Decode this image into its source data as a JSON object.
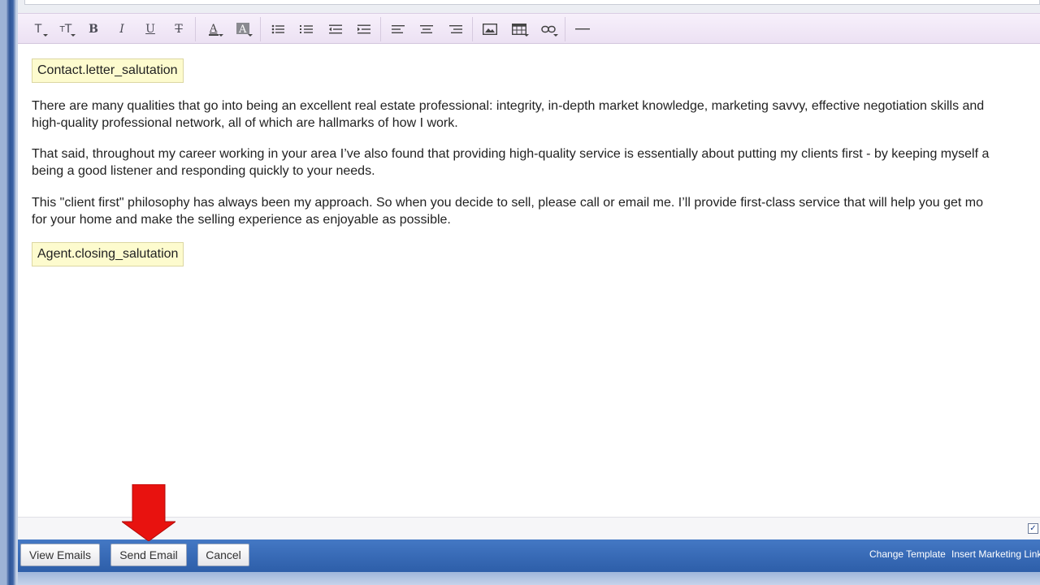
{
  "toolbar": {
    "buttons": [
      {
        "name": "font-family-icon",
        "glyph": "T"
      },
      {
        "name": "font-size-icon",
        "glyph": "тT"
      },
      {
        "name": "bold-icon",
        "glyph": "B"
      },
      {
        "name": "italic-icon",
        "glyph": "I"
      },
      {
        "name": "underline-icon",
        "glyph": "U"
      },
      {
        "name": "strikethrough-icon",
        "glyph": "T"
      },
      {
        "name": "font-color-icon",
        "glyph": "A"
      },
      {
        "name": "highlight-color-icon",
        "glyph": "A"
      }
    ],
    "lists": [
      "bullet-list-icon",
      "numbered-list-icon",
      "outdent-icon",
      "indent-icon"
    ],
    "align": [
      "align-left-icon",
      "align-center-icon",
      "align-right-icon"
    ],
    "insert": [
      "image-icon",
      "table-icon",
      "link-icon"
    ],
    "rule": "horizontal-rule-icon"
  },
  "editor": {
    "salutation_tag": "Contact.letter_salutation",
    "paragraphs": [
      {
        "line1": "There are many qualities that go into being an excellent real estate professional: integrity, in-depth market knowledge, marketing savvy, effective negotiation skills and",
        "line2": "high-quality professional network, all of which are hallmarks of how I work."
      },
      {
        "line1": "That said, throughout my career working in your area I’ve also found that providing high-quality service is essentially about putting my clients first - by keeping myself a",
        "line2": "being a good listener and responding quickly to your needs."
      },
      {
        "line1": "This \"client first\" philosophy has always been my approach. So when you decide to sell, please call or email me. I’ll provide first-class service that will help you get mo",
        "line2": "for your home and make the selling experience as enjoyable as possible."
      }
    ],
    "closing_tag": "Agent.closing_salutation"
  },
  "footer": {
    "view_emails": "View Emails",
    "send_email": "Send Email",
    "cancel": "Cancel",
    "change_template": "Change Template",
    "insert_marketing_link": "Insert Marketing Link"
  },
  "colors": {
    "accent_blue": "#3a6bb8",
    "tag_bg": "#fdfbce",
    "annotation_arrow": "#e8120f"
  }
}
